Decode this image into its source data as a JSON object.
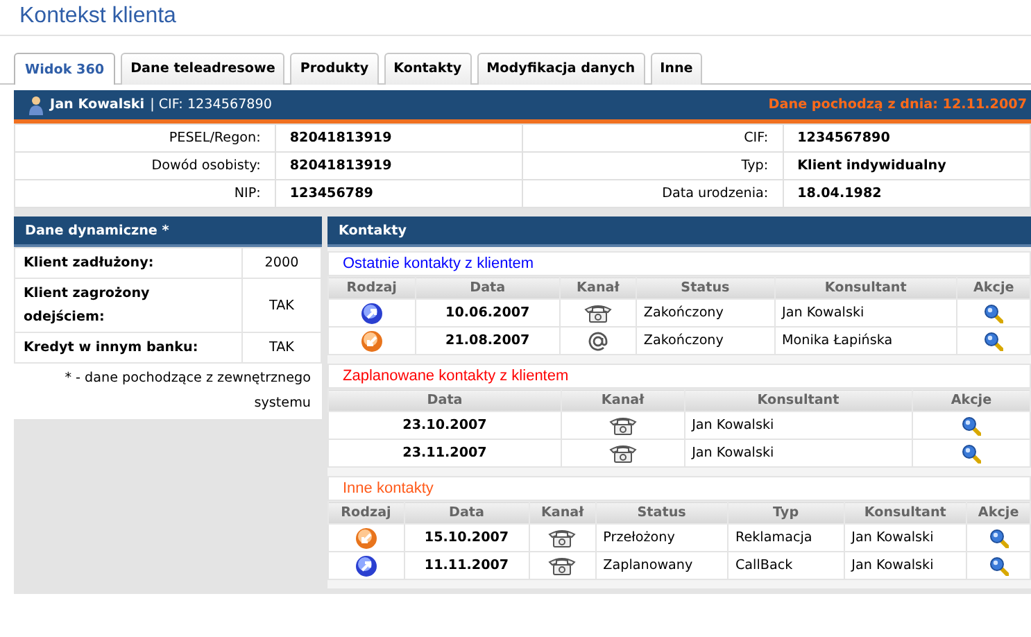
{
  "window": {
    "title": "Kontekst klienta"
  },
  "tabs": [
    {
      "label": "Widok 360",
      "selected": true
    },
    {
      "label": "Dane teleadresowe",
      "selected": false
    },
    {
      "label": "Produkty",
      "selected": false
    },
    {
      "label": "Kontakty",
      "selected": false
    },
    {
      "label": "Modyfikacja danych",
      "selected": false
    },
    {
      "label": "Inne",
      "selected": false
    }
  ],
  "client": {
    "name": "Jan Kowalski",
    "cif": "| CIF: 1234567890",
    "data_date": "Dane pochodzą z dnia: 12.11.2007"
  },
  "details": [
    {
      "label": "PESEL/Regon:",
      "value": "82041813919",
      "label_2": "CIF:",
      "value_2": "1234567890"
    },
    {
      "label": "Dowód osobisty:",
      "value": "82041813919",
      "label_2": "Typ:",
      "value_2": "Klient indywidualny"
    },
    {
      "label": "NIP:",
      "value": "123456789",
      "label_2": "Data urodzenia:",
      "value_2": "18.04.1982"
    }
  ],
  "dynamic": {
    "title": "Dane dynamiczne *",
    "rows": [
      {
        "label": "Klient zadłużony:",
        "value": "2000"
      },
      {
        "label": "Klient zagrożony odejściem:",
        "value": "TAK"
      },
      {
        "label": "Kredyt w innym banku:",
        "value": "TAK"
      }
    ],
    "footnote": "* - dane pochodzące z zewnętrznego systemu"
  },
  "contacts": {
    "title": "Kontakty",
    "sections": [
      {
        "title": "Ostatnie kontakty z klientem",
        "color": "#0000ff",
        "columns": [
          "Rodzaj",
          "Data",
          "Kanał",
          "Status",
          "Konsultant",
          "Akcje"
        ],
        "rows": [
          {
            "cells": [
              {
                "kind": "outbound"
              },
              {
                "kind": "date",
                "text": "10.06.2007"
              },
              {
                "kind": "phone"
              },
              {
                "kind": "text",
                "text": "Zakończony"
              },
              {
                "kind": "text",
                "text": "Jan Kowalski"
              },
              {
                "kind": "action"
              }
            ]
          },
          {
            "cells": [
              {
                "kind": "inbound"
              },
              {
                "kind": "date",
                "text": "21.08.2007"
              },
              {
                "kind": "email"
              },
              {
                "kind": "text",
                "text": "Zakończony"
              },
              {
                "kind": "text",
                "text": "Monika Łapińska"
              },
              {
                "kind": "action"
              }
            ]
          }
        ]
      },
      {
        "title": "Zaplanowane kontakty z klientem",
        "color": "#ff0000",
        "columns": [
          "Data",
          "Kanał",
          "Konsultant",
          "Akcje"
        ],
        "rows": [
          {
            "cells": [
              {
                "kind": "date",
                "text": "23.10.2007"
              },
              {
                "kind": "phone"
              },
              {
                "kind": "text",
                "text": "Jan Kowalski"
              },
              {
                "kind": "action"
              }
            ]
          },
          {
            "cells": [
              {
                "kind": "date",
                "text": "23.11.2007"
              },
              {
                "kind": "phone"
              },
              {
                "kind": "text",
                "text": "Jan Kowalski"
              },
              {
                "kind": "action"
              }
            ]
          }
        ]
      },
      {
        "title": "Inne kontakty",
        "color": "#ff5a1a",
        "columns": [
          "Rodzaj",
          "Data",
          "Kanał",
          "Status",
          "Typ",
          "Konsultant",
          "Akcje"
        ],
        "rows": [
          {
            "cells": [
              {
                "kind": "inbound"
              },
              {
                "kind": "date",
                "text": "15.10.2007"
              },
              {
                "kind": "phone"
              },
              {
                "kind": "text",
                "text": "Przełożony"
              },
              {
                "kind": "text",
                "text": "Reklamacja"
              },
              {
                "kind": "text",
                "text": "Jan Kowalski"
              },
              {
                "kind": "action"
              }
            ]
          },
          {
            "cells": [
              {
                "kind": "outbound"
              },
              {
                "kind": "date",
                "text": "11.11.2007"
              },
              {
                "kind": "phone"
              },
              {
                "kind": "text",
                "text": "Zaplanowany"
              },
              {
                "kind": "text",
                "text": "CallBack"
              },
              {
                "kind": "text",
                "text": "Jan Kowalski"
              },
              {
                "kind": "action"
              }
            ]
          }
        ]
      }
    ]
  }
}
